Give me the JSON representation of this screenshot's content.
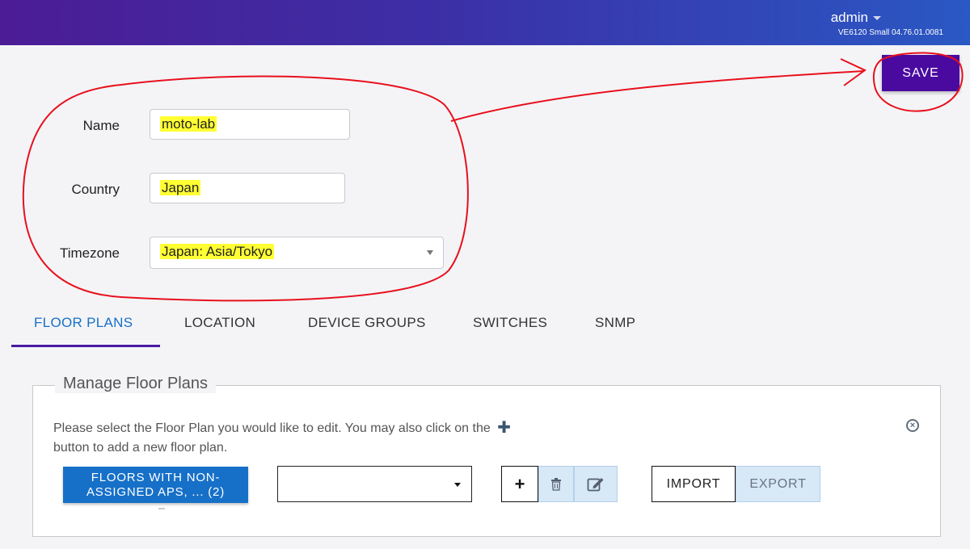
{
  "header": {
    "user": "admin",
    "version": "VE6120 Small 04.76.01.0081",
    "caret_icon": "caret-down-icon"
  },
  "toolbar": {
    "save_label": "SAVE"
  },
  "form": {
    "name": {
      "label": "Name",
      "value": "moto-lab"
    },
    "country": {
      "label": "Country",
      "value": "Japan"
    },
    "timezone": {
      "label": "Timezone",
      "region": "Japan:",
      "zone": "Asia/Tokyo"
    }
  },
  "tabs": [
    {
      "label": "FLOOR PLANS",
      "active": true
    },
    {
      "label": "LOCATION",
      "active": false
    },
    {
      "label": "DEVICE GROUPS",
      "active": false
    },
    {
      "label": "SWITCHES",
      "active": false
    },
    {
      "label": "SNMP",
      "active": false
    }
  ],
  "floor_plans": {
    "legend": "Manage Floor Plans",
    "description_part1": "Please select the Floor Plan you would like to edit. You may also click on the",
    "description_part2": "button to add a new floor plan.",
    "floors_button": "FLOORS WITH NON-ASSIGNED APS, ... (2)",
    "floor_select_value": "",
    "add_symbol": "+",
    "import_label": "IMPORT",
    "export_label": "EXPORT",
    "icons": [
      "plus-icon",
      "trash-icon",
      "edit-icon",
      "close-circle-icon"
    ]
  },
  "colors": {
    "header_start": "#4c1c95",
    "header_end": "#2a58c4",
    "save_button": "#4a0aa0",
    "primary_blue": "#1670c8",
    "highlight": "#ffff33",
    "annotation_red": "#e8101c"
  }
}
